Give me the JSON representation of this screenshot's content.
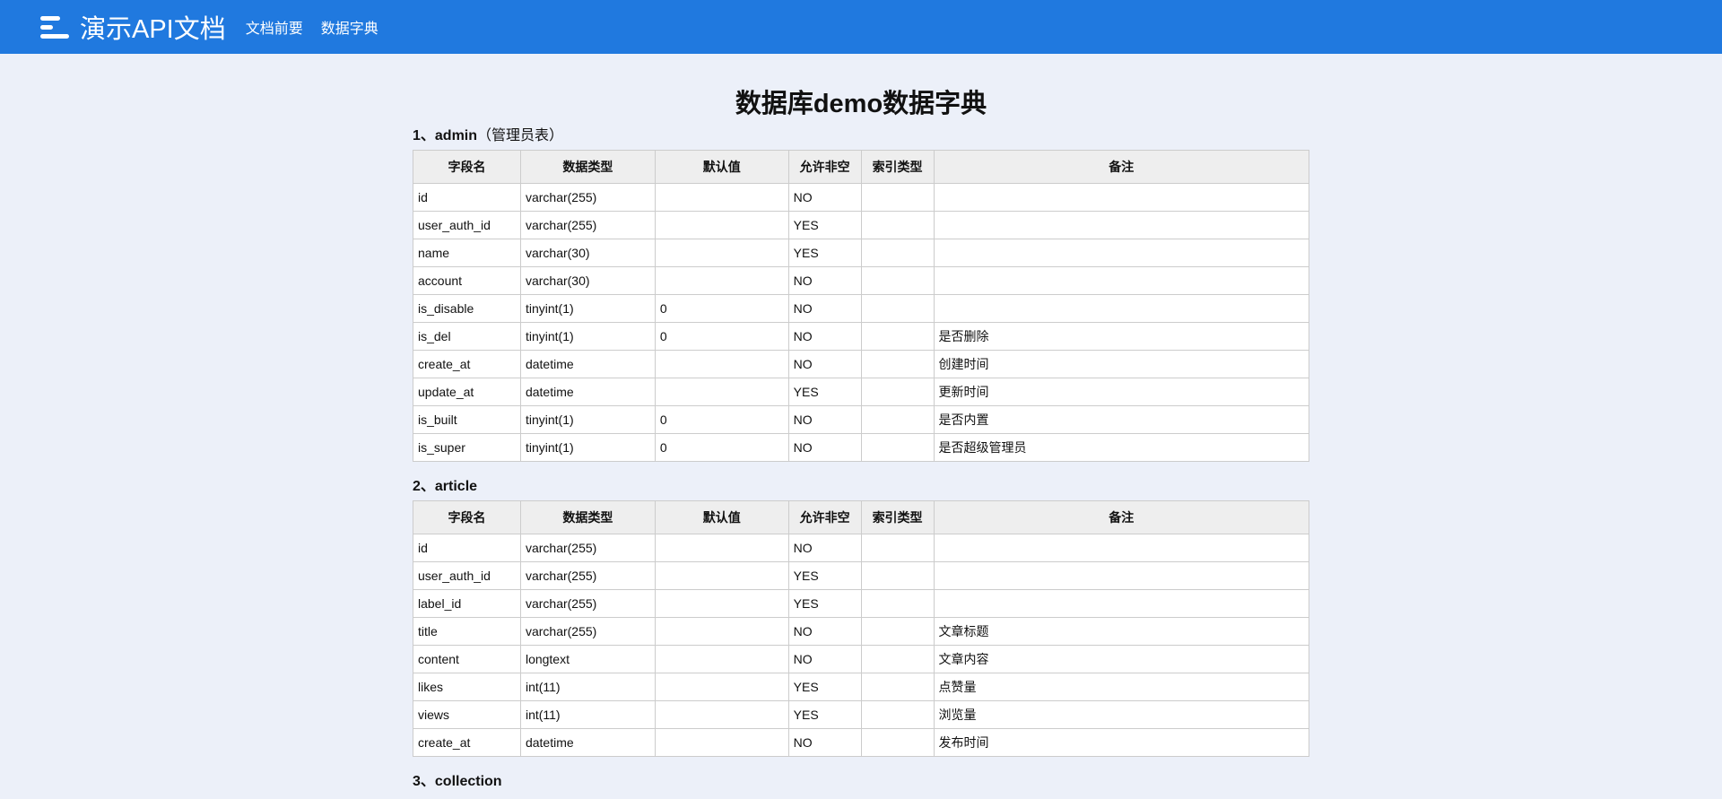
{
  "header": {
    "brand": "演示API文档",
    "nav": [
      "文档前要",
      "数据字典"
    ]
  },
  "title": "数据库demo数据字典",
  "columns": [
    "字段名",
    "数据类型",
    "默认值",
    "允许非空",
    "索引类型",
    "备注"
  ],
  "tables": [
    {
      "heading": "1、admin",
      "comment": "（管理员表）",
      "rows": [
        [
          "id",
          "varchar(255)",
          "",
          "NO",
          "",
          ""
        ],
        [
          "user_auth_id",
          "varchar(255)",
          "",
          "YES",
          "",
          ""
        ],
        [
          "name",
          "varchar(30)",
          "",
          "YES",
          "",
          ""
        ],
        [
          "account",
          "varchar(30)",
          "",
          "NO",
          "",
          ""
        ],
        [
          "is_disable",
          "tinyint(1)",
          "0",
          "NO",
          "",
          ""
        ],
        [
          "is_del",
          "tinyint(1)",
          "0",
          "NO",
          "",
          "是否删除"
        ],
        [
          "create_at",
          "datetime",
          "",
          "NO",
          "",
          "创建时间"
        ],
        [
          "update_at",
          "datetime",
          "",
          "YES",
          "",
          "更新时间"
        ],
        [
          "is_built",
          "tinyint(1)",
          "0",
          "NO",
          "",
          "是否内置"
        ],
        [
          "is_super",
          "tinyint(1)",
          "0",
          "NO",
          "",
          "是否超级管理员"
        ]
      ]
    },
    {
      "heading": "2、article",
      "comment": "",
      "rows": [
        [
          "id",
          "varchar(255)",
          "",
          "NO",
          "",
          ""
        ],
        [
          "user_auth_id",
          "varchar(255)",
          "",
          "YES",
          "",
          ""
        ],
        [
          "label_id",
          "varchar(255)",
          "",
          "YES",
          "",
          ""
        ],
        [
          "title",
          "varchar(255)",
          "",
          "NO",
          "",
          "文章标题"
        ],
        [
          "content",
          "longtext",
          "",
          "NO",
          "",
          "文章内容"
        ],
        [
          "likes",
          "int(11)",
          "",
          "YES",
          "",
          "点赞量"
        ],
        [
          "views",
          "int(11)",
          "",
          "YES",
          "",
          "浏览量"
        ],
        [
          "create_at",
          "datetime",
          "",
          "NO",
          "",
          "发布时间"
        ]
      ]
    },
    {
      "heading": "3、collection",
      "comment": "",
      "rows": []
    }
  ]
}
